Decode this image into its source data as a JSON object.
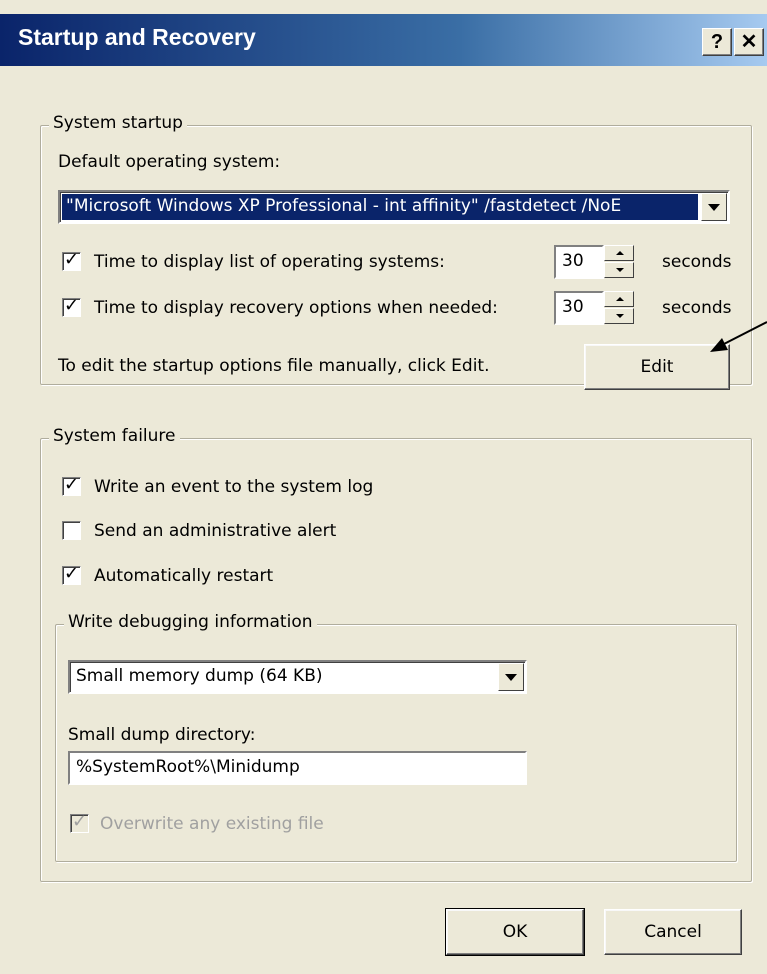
{
  "window": {
    "title": "Startup and Recovery",
    "help_label": "?",
    "close_label": "✕"
  },
  "startup": {
    "group_label": "System startup",
    "default_os_label": "Default operating system:",
    "default_os_value": "\"Microsoft Windows XP Professional - int affinity\" /fastdetect /NoE",
    "time_list_label": "Time to display list of operating systems:",
    "time_list_checked": true,
    "time_list_value": "30",
    "time_recovery_label": "Time to display recovery options when needed:",
    "time_recovery_checked": true,
    "time_recovery_value": "30",
    "seconds_label": "seconds",
    "edit_hint": "To edit the startup options file manually, click Edit.",
    "edit_button": "Edit"
  },
  "failure": {
    "group_label": "System failure",
    "write_event_label": "Write an event to the system log",
    "write_event_checked": true,
    "admin_alert_label": "Send an administrative alert",
    "admin_alert_checked": false,
    "auto_restart_label": "Automatically restart",
    "auto_restart_checked": true,
    "debug": {
      "group_label": "Write debugging information",
      "dump_type_value": "Small memory dump (64 KB)",
      "dump_dir_label": "Small dump directory:",
      "dump_dir_value": "%SystemRoot%\\Minidump",
      "overwrite_label": "Overwrite any existing file",
      "overwrite_checked": true
    }
  },
  "footer": {
    "ok_label": "OK",
    "cancel_label": "Cancel"
  },
  "check_glyph": "✓"
}
